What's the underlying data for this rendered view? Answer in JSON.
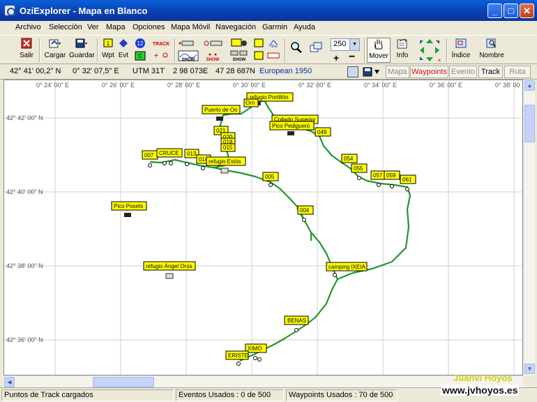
{
  "window": {
    "title": "OziExplorer - Mapa en Blanco",
    "minimize": "_",
    "maximize": "□",
    "close": "✕"
  },
  "menu": [
    "Archivo",
    "Selección",
    "Ver",
    "Mapa",
    "Opciones",
    "Mapa Móvil",
    "Navegación",
    "Garmin",
    "Ayuda"
  ],
  "toolbar": {
    "exit": "Salir",
    "load": "Cargar",
    "save": "Guardar",
    "wpt": "Wpt",
    "evt": "Evt",
    "track_tag": "TRACK",
    "show1": "SHOW",
    "show2": "SHOW",
    "show3": "SHOW",
    "line_tag": "line",
    "num12": "12",
    "num1": "1",
    "numc": "C",
    "zoom_value": "250",
    "move": "Mover",
    "info": "Info",
    "index": "Índice",
    "name": "Nombre"
  },
  "coords": {
    "lat": "42° 41' 00,2\" N",
    "lon": "0° 32' 07,5\" E",
    "utm_zone": "UTM  31T",
    "easting": "2 98 073E",
    "northing": "47 28 687N",
    "datum": "European 1950"
  },
  "modes": [
    "Mapa",
    "Waypoints",
    "Evento",
    "Track",
    "Ruta"
  ],
  "map": {
    "lon_labels": [
      "0° 24' 00\" E",
      "0° 26' 00\" E",
      "0° 28' 00\" E",
      "0° 30' 00\" E",
      "0° 32' 00\" E",
      "0° 34' 00\" E",
      "0° 36' 00\" E",
      "0° 38' 00"
    ],
    "lat_labels": [
      "42° 42' 00\" N",
      "42° 40' 00\" N",
      "42° 38' 00\" N",
      "42° 36' 00\" N"
    ],
    "waypoints": [
      "refugio Portillón",
      "Puerto de Oo",
      "Collado Superior",
      "Pico Pedigueró",
      "Orn",
      "049",
      "007",
      "CRUCE",
      "013",
      "014",
      "refugio Estós",
      "021",
      "020",
      "018",
      "015",
      "054",
      "055",
      "005",
      "057",
      "059",
      "061",
      "Pico Posets",
      "004",
      "refugio Ángel Orús",
      "camping IXEIA",
      "BENAS",
      "XIMO",
      "ERISTE"
    ],
    "colors": {
      "track": "#22962b",
      "label_fill": "#ffff00",
      "grid": "#cfcfcf"
    }
  },
  "status": {
    "track_points": "Puntos de Track cargados",
    "events": "Eventos Usados : 0 de 500",
    "waypoints": "Waypoints Usados : 70 de 500"
  },
  "watermark": {
    "name": "Juanvi Hoyos",
    "url": "www.jvhoyos.es"
  }
}
